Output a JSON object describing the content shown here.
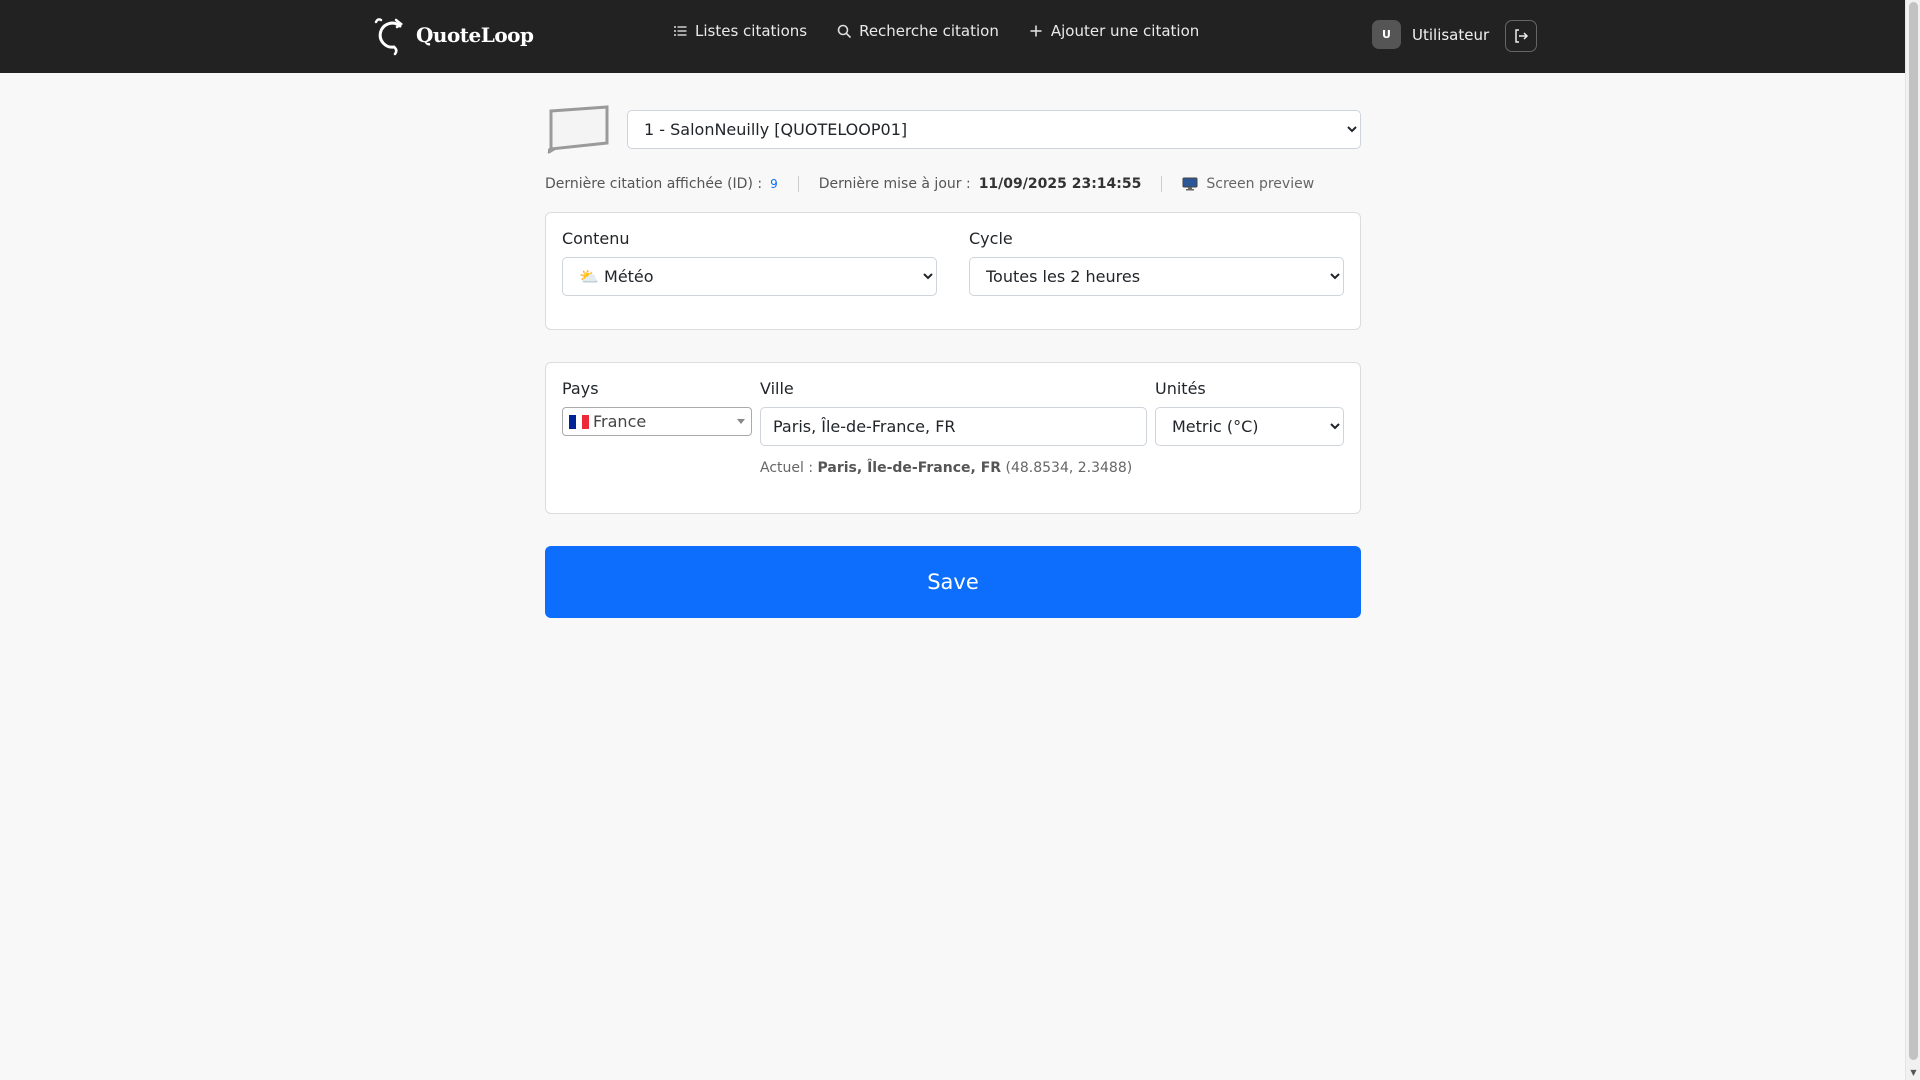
{
  "app": {
    "name": "QuoteLoop"
  },
  "nav": {
    "links": [
      {
        "label": "Listes citations",
        "icon": "list-icon"
      },
      {
        "label": "Recherche citation",
        "icon": "search-icon"
      },
      {
        "label": "Ajouter une citation",
        "icon": "plus-icon"
      }
    ],
    "user_initial": "U",
    "user_name": "Utilisateur",
    "logout_icon": "logout-icon"
  },
  "device": {
    "selected": "1 - SalonNeuilly [QUOTELOOP01]"
  },
  "meta": {
    "last_quote_label": "Dernière citation affichée (ID) :",
    "last_quote_id": "9",
    "last_update_label": "Dernière mise à jour :",
    "last_update_value": "11/09/2025 23:14:55",
    "preview_label": "Screen preview"
  },
  "content_card": {
    "content_label": "Contenu",
    "content_value": "⛅ Météo",
    "cycle_label": "Cycle",
    "cycle_value": "Toutes les 2 heures"
  },
  "weather_card": {
    "country_label": "Pays",
    "country_value": "France",
    "city_label": "Ville",
    "city_value": "Paris, Île-de-France, FR",
    "units_label": "Unités",
    "units_value": "Metric (°C)",
    "current_prefix": "Actuel :",
    "current_place": "Paris, Île-de-France, FR",
    "current_coords": "(48.8534, 2.3488)"
  },
  "save_label": "Save",
  "colors": {
    "navbar": "#222222",
    "primary": "#0d6efd",
    "background": "#f8f8f8"
  }
}
